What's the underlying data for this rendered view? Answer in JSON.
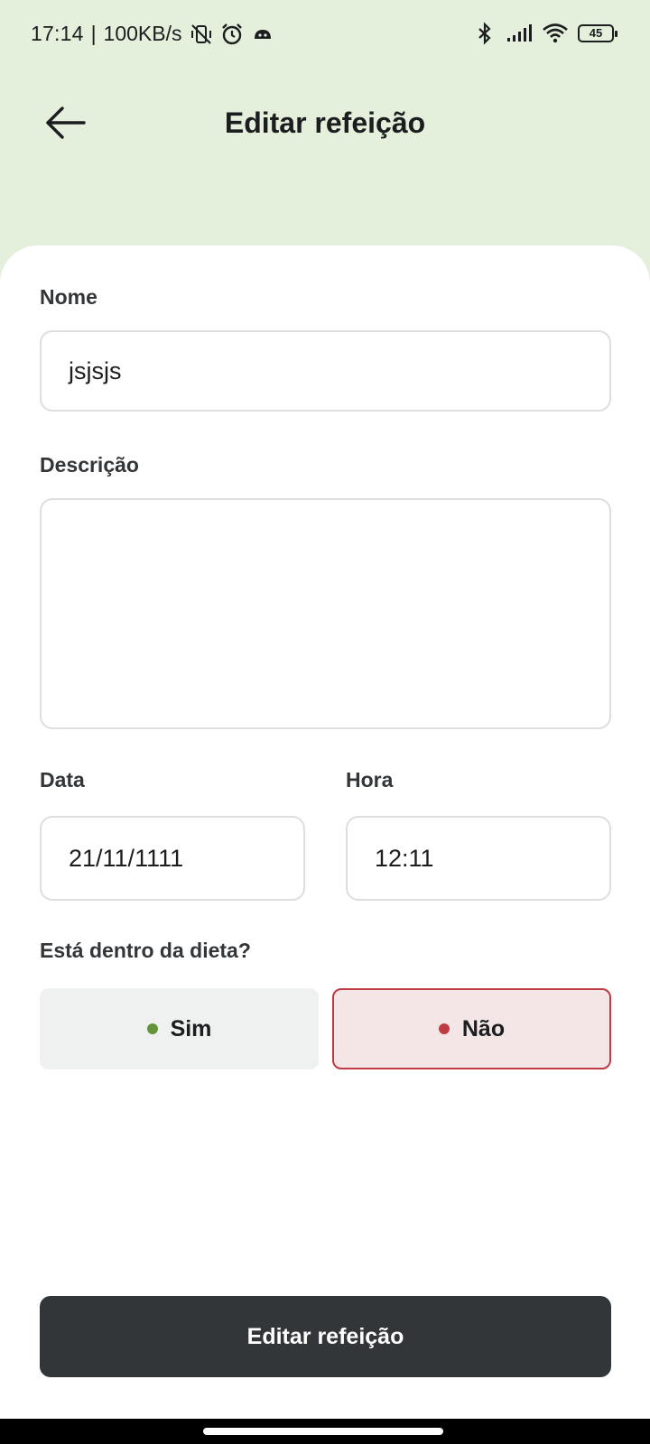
{
  "status_bar": {
    "time": "17:14",
    "separator": "|",
    "speed": "100KB/s",
    "battery": "45",
    "icons": [
      "vibrate-off-icon",
      "alarm-icon",
      "app-notification-icon",
      "bluetooth-icon",
      "signal-icon",
      "wifi-icon",
      "battery-icon"
    ]
  },
  "header": {
    "title": "Editar refeição",
    "back_icon": "arrow-left-icon"
  },
  "form": {
    "name_label": "Nome",
    "name_value": "jsjsjs",
    "description_label": "Descrição",
    "description_value": "",
    "date_label": "Data",
    "date_value": "21/11/1111",
    "time_label": "Hora",
    "time_value": "12:11",
    "diet_question": "Está dentro da dieta?",
    "diet_yes": "Sim",
    "diet_no": "Não",
    "selected": "Não"
  },
  "submit_label": "Editar refeição",
  "colors": {
    "header_bg": "#e4efdc",
    "yes_dot": "#639339",
    "no_dot": "#bf3b44",
    "no_selected_bg": "#f4e6e7",
    "button_dark": "#333638"
  }
}
